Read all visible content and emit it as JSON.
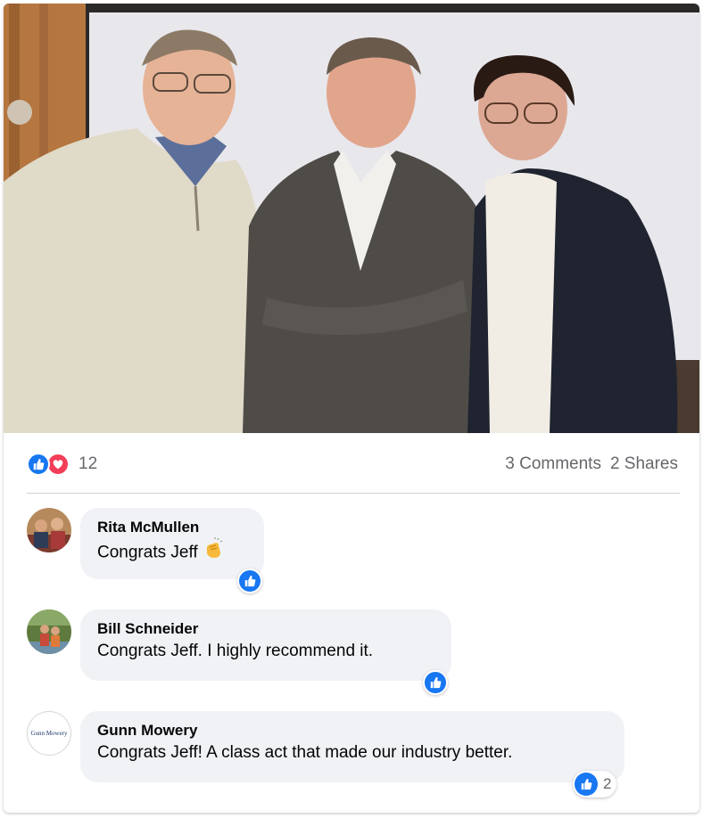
{
  "post": {
    "photo_description": "Three people standing together in a room",
    "reaction_count": "12",
    "comments_label": "3 Comments",
    "shares_label": "2 Shares"
  },
  "comments": [
    {
      "author": "Rita McMullen",
      "text": "Congrats Jeff",
      "has_clap_emoji": true,
      "likes": ""
    },
    {
      "author": "Bill Schneider",
      "text": "Congrats Jeff. I highly recommend it.",
      "has_clap_emoji": false,
      "likes": ""
    },
    {
      "author": "Gunn Mowery",
      "text": "Congrats Jeff! A class act that made our industry better.",
      "has_clap_emoji": false,
      "likes": "2"
    }
  ],
  "logos": {
    "gunn_mowery_avatar_text": "Gunn Mowery"
  },
  "colors": {
    "like_blue": "#1877f2",
    "love_red": "#f33e58",
    "bubble_bg": "#f0f2f5",
    "muted_text": "#65676b"
  }
}
